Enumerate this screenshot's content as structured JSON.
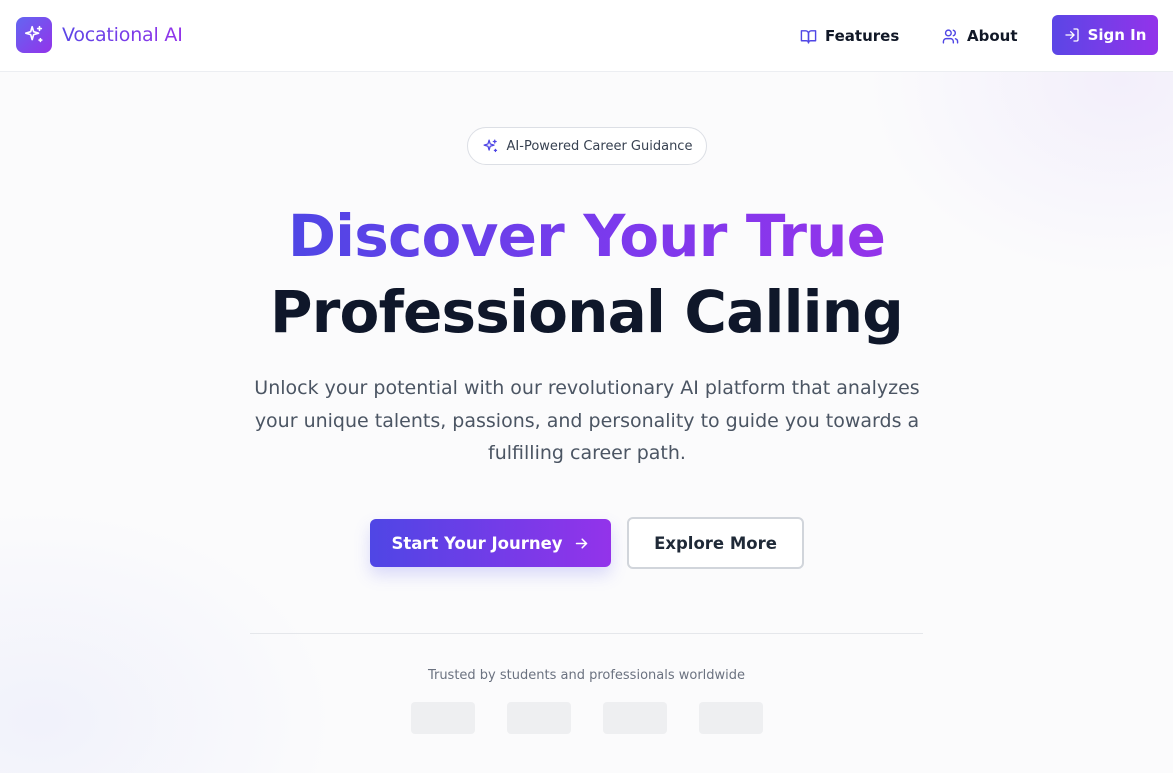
{
  "brand": {
    "name": "Vocational AI",
    "logo_icon": "sparkles-icon"
  },
  "nav": {
    "features_label": "Features",
    "features_icon": "book-open-icon",
    "about_label": "About",
    "about_icon": "users-icon",
    "signin_label": "Sign In",
    "signin_icon": "log-in-icon"
  },
  "hero": {
    "badge_label": "AI-Powered Career Guidance",
    "badge_icon": "sparkles-icon",
    "headline_line1": "Discover Your True",
    "headline_line2": "Professional Calling",
    "subtitle": "Unlock your potential with our revolutionary AI platform that analyzes your unique talents, passions, and personality to guide you towards a fulfilling career path.",
    "primary_cta": "Start Your Journey",
    "primary_cta_icon": "arrow-right-icon",
    "secondary_cta": "Explore More"
  },
  "trust": {
    "text": "Trusted by students and professionals worldwide",
    "logo_placeholders": 4
  },
  "colors": {
    "gradient_start": "#4f46e5",
    "gradient_end": "#9333ea",
    "headline_dark": "#0f172a"
  }
}
